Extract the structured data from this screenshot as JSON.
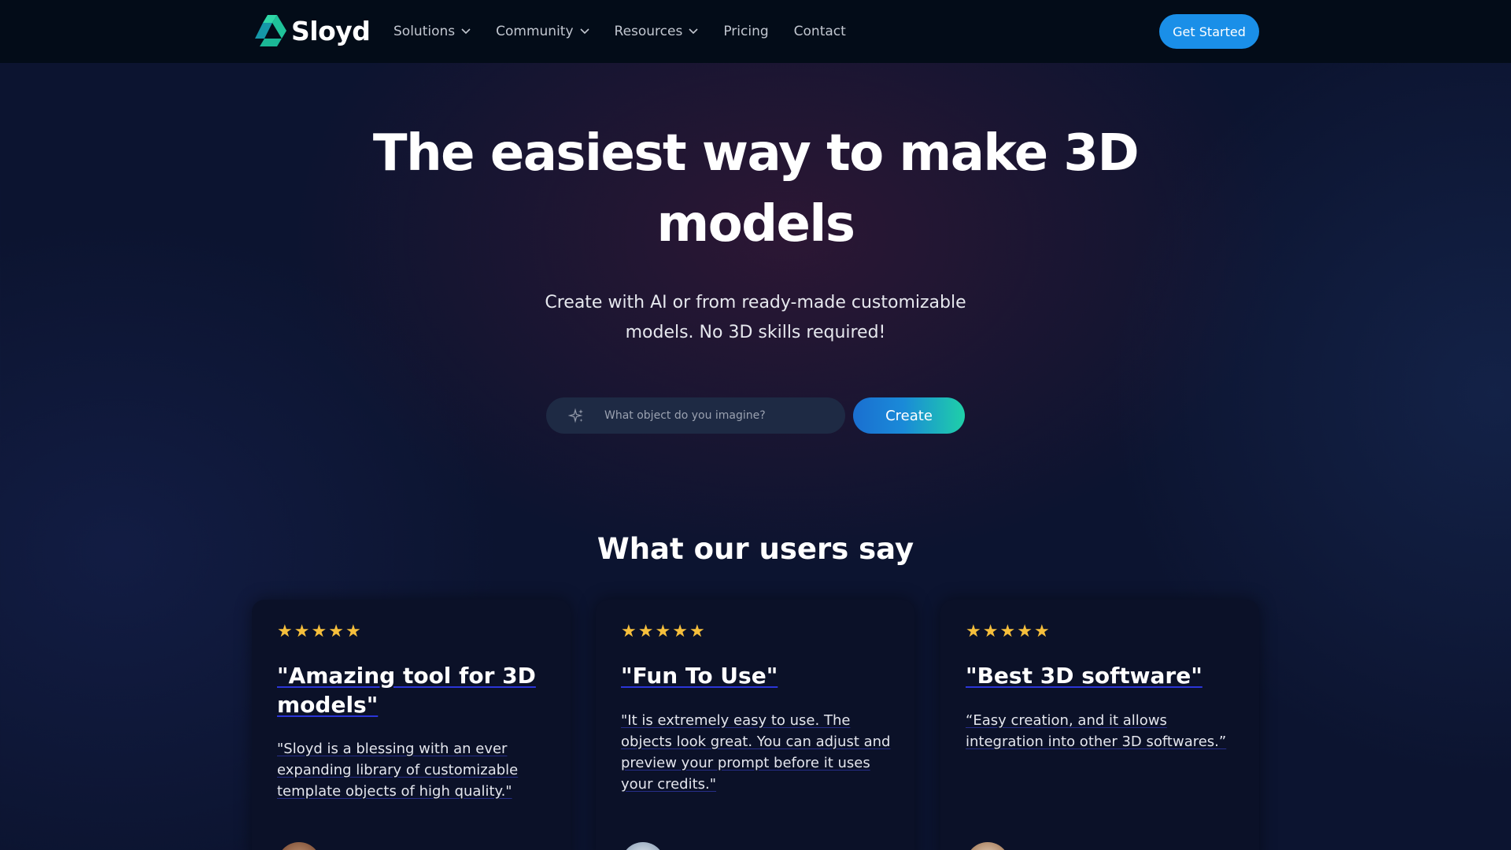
{
  "nav": {
    "brand": "Sloyd",
    "links": [
      {
        "label": "Solutions",
        "dropdown": true
      },
      {
        "label": "Community",
        "dropdown": true
      },
      {
        "label": "Resources",
        "dropdown": true
      },
      {
        "label": "Pricing",
        "dropdown": false
      },
      {
        "label": "Contact",
        "dropdown": false
      }
    ],
    "cta": "Get Started"
  },
  "hero": {
    "title": "The easiest way to make 3D models",
    "subtitle": "Create with AI or from ready-made customizable models. No 3D skills required!",
    "search_placeholder": "What object do you imagine?",
    "create_label": "Create"
  },
  "testimonials": {
    "heading": "What our users say",
    "cards": [
      {
        "rating": 5,
        "title": "\"Amazing tool for 3D models\"",
        "text": "\"Sloyd is a blessing with an ever expanding library of customizable template objects of high quality.\""
      },
      {
        "rating": 5,
        "title": "\"Fun To Use\"",
        "text": "\"It is extremely easy to use. The objects look great. You can adjust and preview your prompt before it uses your credits.\""
      },
      {
        "rating": 5,
        "title": "\"Best 3D software\"",
        "text": "“Easy creation, and it allows integration into other 3D softwares.”"
      }
    ]
  },
  "colors": {
    "nav_bg": "#030c18",
    "cta_blue": "#1a8fe8",
    "star": "#f6bf3c",
    "logo_teal": "#1fd0a8"
  }
}
